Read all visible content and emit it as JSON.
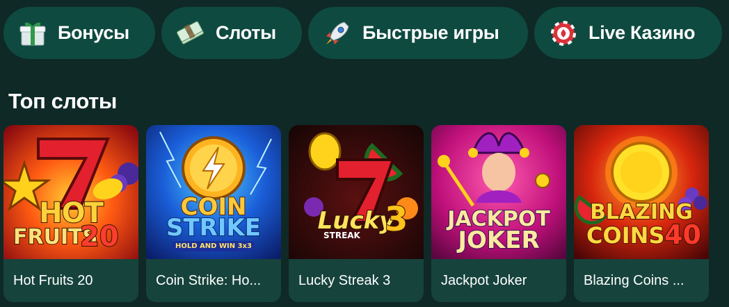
{
  "categories": [
    {
      "label": "Бонусы",
      "icon": "gift-icon"
    },
    {
      "label": "Слоты",
      "icon": "cash-stack-icon"
    },
    {
      "label": "Быстрые игры",
      "icon": "rocket-icon"
    },
    {
      "label": "Live Казино",
      "icon": "poker-chip-icon"
    }
  ],
  "section_title": "Топ слоты",
  "slots": [
    {
      "name": "Hot Fruits 20",
      "art_lines": [
        "HOT",
        "FRUITS",
        "20"
      ],
      "icon": "hot-fruits-thumbnail"
    },
    {
      "name": "Coin Strike: Ho...",
      "art_lines": [
        "COIN",
        "STRIKE",
        "HOLD AND WIN 3x3"
      ],
      "icon": "coin-strike-thumbnail"
    },
    {
      "name": "Lucky Streak 3",
      "art_lines": [
        "Lucky",
        "STREAK",
        "3"
      ],
      "icon": "lucky-streak-thumbnail"
    },
    {
      "name": "Jackpot Joker",
      "art_lines": [
        "JACKPOT",
        "JOKER"
      ],
      "icon": "jackpot-joker-thumbnail"
    },
    {
      "name": "Blazing Coins ...",
      "art_lines": [
        "BLAZING",
        "COINS",
        "40"
      ],
      "icon": "blazing-coins-thumbnail"
    }
  ],
  "colors": {
    "background": "#0f2a26",
    "pill": "#0e4a40",
    "card": "#16433c",
    "text": "#ffffff"
  }
}
